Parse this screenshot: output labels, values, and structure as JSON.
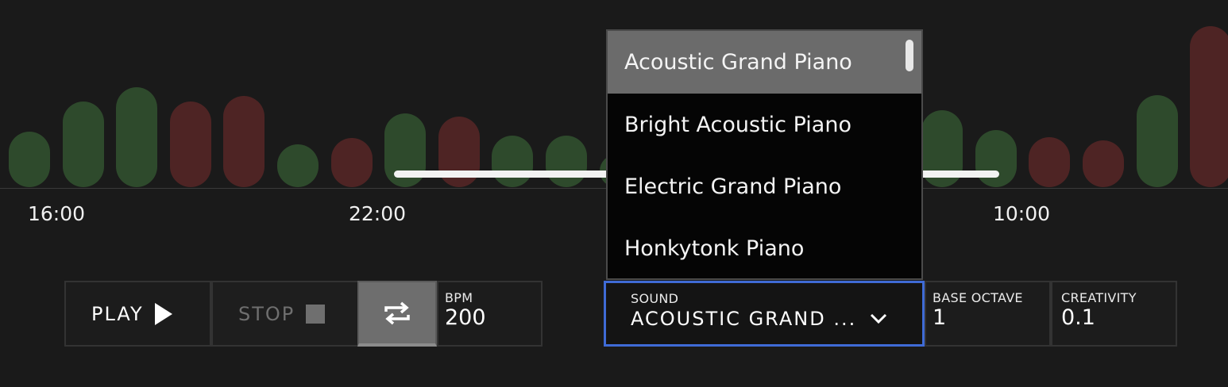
{
  "visualizer": {
    "bars": [
      {
        "dir": "up",
        "level": 0.52
      },
      {
        "dir": "up",
        "level": 0.8
      },
      {
        "dir": "up",
        "level": 0.93
      },
      {
        "dir": "down",
        "level": 0.8
      },
      {
        "dir": "down",
        "level": 0.85
      },
      {
        "dir": "up",
        "level": 0.4
      },
      {
        "dir": "down",
        "level": 0.46
      },
      {
        "dir": "up",
        "level": 0.69
      },
      {
        "dir": "down",
        "level": 0.66
      },
      {
        "dir": "up",
        "level": 0.48
      },
      {
        "dir": "up",
        "level": 0.48
      },
      {
        "dir": "up",
        "level": 0.3
      },
      {
        "dir": "up",
        "level": 0.25
      },
      {
        "dir": "up",
        "level": 0.25
      },
      {
        "dir": "up",
        "level": 0.25
      },
      {
        "dir": "up",
        "level": 0.25
      },
      {
        "dir": "up",
        "level": 0.25
      },
      {
        "dir": "up",
        "level": 0.72
      },
      {
        "dir": "up",
        "level": 0.53
      },
      {
        "dir": "down",
        "level": 0.47
      },
      {
        "dir": "down",
        "level": 0.44
      },
      {
        "dir": "up",
        "level": 0.86
      },
      {
        "dir": "down",
        "level": 1.5
      }
    ],
    "time_labels": [
      "16:00",
      "22:00",
      "10:00"
    ]
  },
  "controls": {
    "play_label": "PLAY",
    "stop_label": "STOP",
    "loop_active": true,
    "bpm": {
      "label": "BPM",
      "value": "200"
    },
    "sound": {
      "label": "SOUND",
      "value": "ACOUSTIC GRAND ..."
    },
    "base_octave": {
      "label": "BASE OCTAVE",
      "value": "1"
    },
    "creativity": {
      "label": "CREATIVITY",
      "value": "0.1"
    }
  },
  "sound_dropdown": {
    "options": [
      "Acoustic Grand Piano",
      "Bright Acoustic Piano",
      "Electric Grand Piano",
      "Honkytonk Piano"
    ],
    "selected": "Acoustic Grand Piano"
  },
  "colors": {
    "background": "#1a1a1a",
    "bar_up": "#2e4a2c",
    "bar_down": "#4e2424",
    "focus_border": "#3f6bd6"
  }
}
